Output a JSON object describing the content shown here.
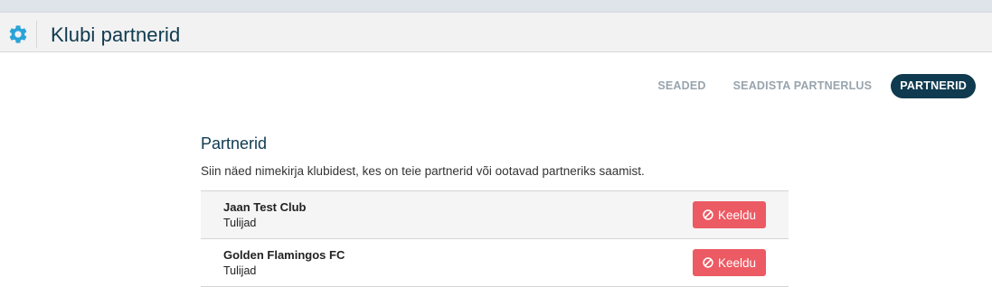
{
  "header": {
    "title": "Klubi partnerid",
    "icon": "gear-icon",
    "icon_color": "#2aa3d8"
  },
  "tabs": [
    {
      "label": "SEADED",
      "active": false
    },
    {
      "label": "SEADISTA PARTNERLUS",
      "active": false
    },
    {
      "label": "PARTNERID",
      "active": true
    }
  ],
  "main": {
    "title": "Partnerid",
    "description": "Siin näed nimekirja klubidest, kes on teie partnerid või ootavad partneriks saamist.",
    "partners": [
      {
        "name": "Jaan Test Club",
        "status": "Tulijad",
        "action_label": "Keeldu",
        "action_icon": "ban-icon"
      },
      {
        "name": "Golden Flamingos FC",
        "status": "Tulijad",
        "action_label": "Keeldu",
        "action_icon": "ban-icon"
      }
    ]
  },
  "colors": {
    "brand_dark": "#0f3a4f",
    "danger": "#ec5a63",
    "tab_inactive": "#98a4ad"
  }
}
